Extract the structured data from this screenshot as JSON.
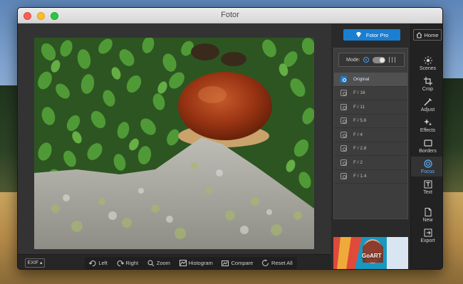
{
  "window": {
    "title": "Fotor"
  },
  "top_panel": {
    "pro_label": "Fotor Pro",
    "home_label": "Home"
  },
  "focus_panel": {
    "mode_label": "Mode:",
    "options": [
      {
        "label": "Original",
        "selected": true
      },
      {
        "label": "F / 16",
        "selected": false
      },
      {
        "label": "F / 11",
        "selected": false
      },
      {
        "label": "F / 5.6",
        "selected": false
      },
      {
        "label": "F / 4",
        "selected": false
      },
      {
        "label": "F / 2.8",
        "selected": false
      },
      {
        "label": "F / 2",
        "selected": false
      },
      {
        "label": "F / 1.4",
        "selected": false
      }
    ]
  },
  "ad": {
    "text": "GoART"
  },
  "sidebar": {
    "items": [
      {
        "label": "Scenes",
        "icon": "scenes-icon",
        "active": false
      },
      {
        "label": "Crop",
        "icon": "crop-icon",
        "active": false
      },
      {
        "label": "Adjust",
        "icon": "adjust-icon",
        "active": false
      },
      {
        "label": "Effects",
        "icon": "effects-icon",
        "active": false
      },
      {
        "label": "Borders",
        "icon": "borders-icon",
        "active": false
      },
      {
        "label": "Focus",
        "icon": "focus-icon",
        "active": true
      },
      {
        "label": "Text",
        "icon": "text-icon",
        "active": false
      },
      {
        "label": "New",
        "icon": "new-icon",
        "active": false
      },
      {
        "label": "Export",
        "icon": "export-icon",
        "active": false
      }
    ]
  },
  "bottom_bar": {
    "exif_label": "EXIF",
    "tools": [
      {
        "label": "Left",
        "icon": "rotate-left-icon"
      },
      {
        "label": "Right",
        "icon": "rotate-right-icon"
      },
      {
        "label": "Zoom",
        "icon": "zoom-icon"
      },
      {
        "label": "Histogram",
        "icon": "histogram-icon"
      },
      {
        "label": "Compare",
        "icon": "compare-icon"
      },
      {
        "label": "Reset All",
        "icon": "reset-icon"
      }
    ]
  },
  "colors": {
    "accent": "#1b7fd1",
    "active_text": "#5db2ff",
    "panel": "#2a2a2a"
  }
}
